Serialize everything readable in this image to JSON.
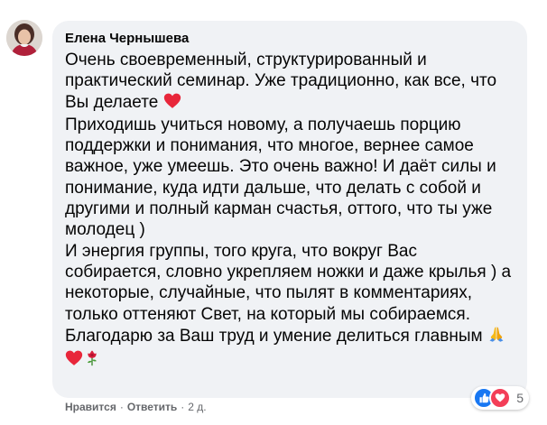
{
  "comment": {
    "author": "Елена Чернышева",
    "paragraphs": [
      {
        "text": "Очень своевременный, структурированный и практический семинар. Уже традиционно, как все, что Вы делаете",
        "emoji_after": [
          "heart"
        ]
      },
      {
        "text": "Приходишь учиться новому, а получаешь порцию поддержки и понимания, что многое, вернее самое важное, уже умеешь. Это очень важно! И даёт силы и понимание, куда идти дальше, что делать с собой и другими и полный карман счастья, оттого, что ты уже молодец )",
        "emoji_after": []
      },
      {
        "text": "И энергия группы, того круга, что вокруг Вас собирается, словно укрепляем ножки и даже крылья ) а некоторые, случайные, что пылят в комментариях, только оттеняют Свет, на который мы собираемся.",
        "emoji_after": []
      },
      {
        "text": "Благодарю за Ваш труд и умение делиться главным",
        "emoji_after": [
          "folded-hands",
          "heart",
          "rose"
        ]
      }
    ],
    "reactions": {
      "types": [
        "like",
        "love"
      ],
      "count": "5"
    },
    "actions": {
      "like_label": "Нравится",
      "reply_label": "Ответить",
      "timestamp": "2 д."
    },
    "colors": {
      "bubble": "#f0f2f5",
      "meta_text": "#65676b",
      "like": "#1877f2",
      "love": "#f33e58",
      "heart": "#e8263a"
    }
  }
}
